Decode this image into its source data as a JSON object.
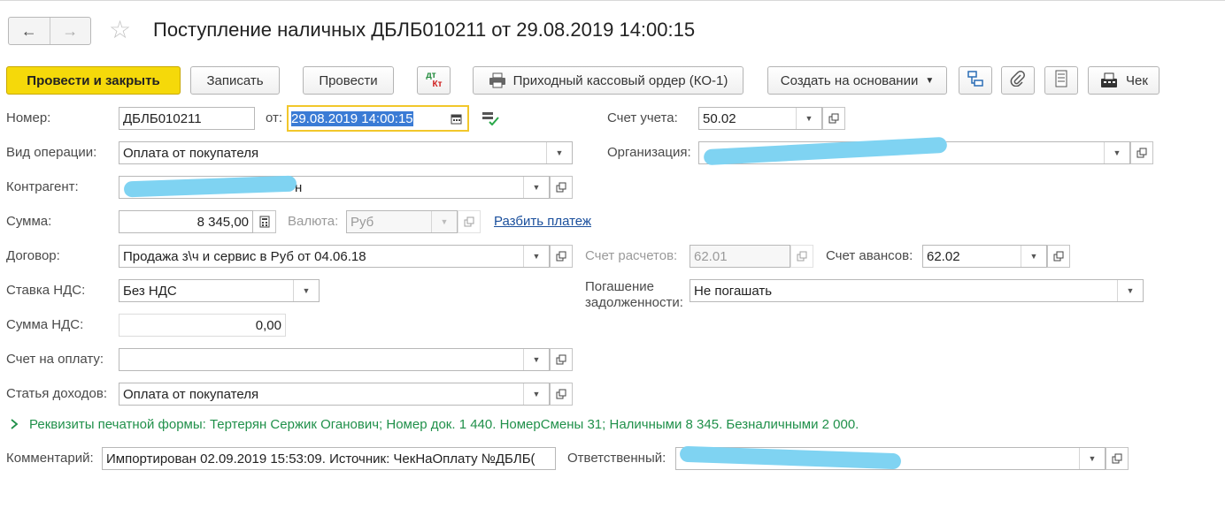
{
  "header": {
    "title": "Поступление наличных ДБЛБ010211 от 29.08.2019 14:00:15",
    "back": "←",
    "forward": "→"
  },
  "toolbar": {
    "post_close": "Провести и закрыть",
    "save": "Записать",
    "post": "Провести",
    "dt": "дт",
    "kt": "Кт",
    "print_order": "Приходный кассовый ордер (КО-1)",
    "create_based": "Создать на основании",
    "check": "Чек"
  },
  "form": {
    "number_label": "Номер:",
    "number_value": "ДБЛБ010211",
    "date_label": "от:",
    "date_value": "29.08.2019 14:00:15",
    "account_label": "Счет учета:",
    "account_value": "50.02",
    "operation_label": "Вид операции:",
    "operation_value": "Оплата от покупателя",
    "org_label": "Организация:",
    "counterparty_label": "Контрагент:",
    "counterparty_tail": "н",
    "sum_label": "Сумма:",
    "sum_value": "8 345,00",
    "currency_label": "Валюта:",
    "currency_value": "Руб",
    "split_link": "Разбить платеж",
    "contract_label": "Договор:",
    "contract_value": "Продажа з\\ч и сервис в Руб от 04.06.18",
    "settle_account_label": "Счет расчетов:",
    "settle_account_value": "62.01",
    "advance_account_label": "Счет авансов:",
    "advance_account_value": "62.02",
    "vat_rate_label": "Ставка НДС:",
    "vat_rate_value": "Без НДС",
    "repay_label_1": "Погашение",
    "repay_label_2": "задолженности:",
    "repay_value": "Не погашать",
    "vat_sum_label": "Сумма НДС:",
    "vat_sum_value": "0,00",
    "invoice_label": "Счет на оплату:",
    "invoice_value": "",
    "income_item_label": "Статья доходов:",
    "income_item_value": "Оплата от покупателя",
    "print_details": "Реквизиты печатной формы: Тертерян Сержик Оганович; Номер док. 1 440. НомерСмены 31; Наличными 8 345. Безналичными 2 000.",
    "comment_label": "Комментарий:",
    "comment_value": "Импортирован 02.09.2019 15:53:09. Источник: ЧекНаОплату №ДБЛБ(",
    "responsible_label": "Ответственный:"
  }
}
